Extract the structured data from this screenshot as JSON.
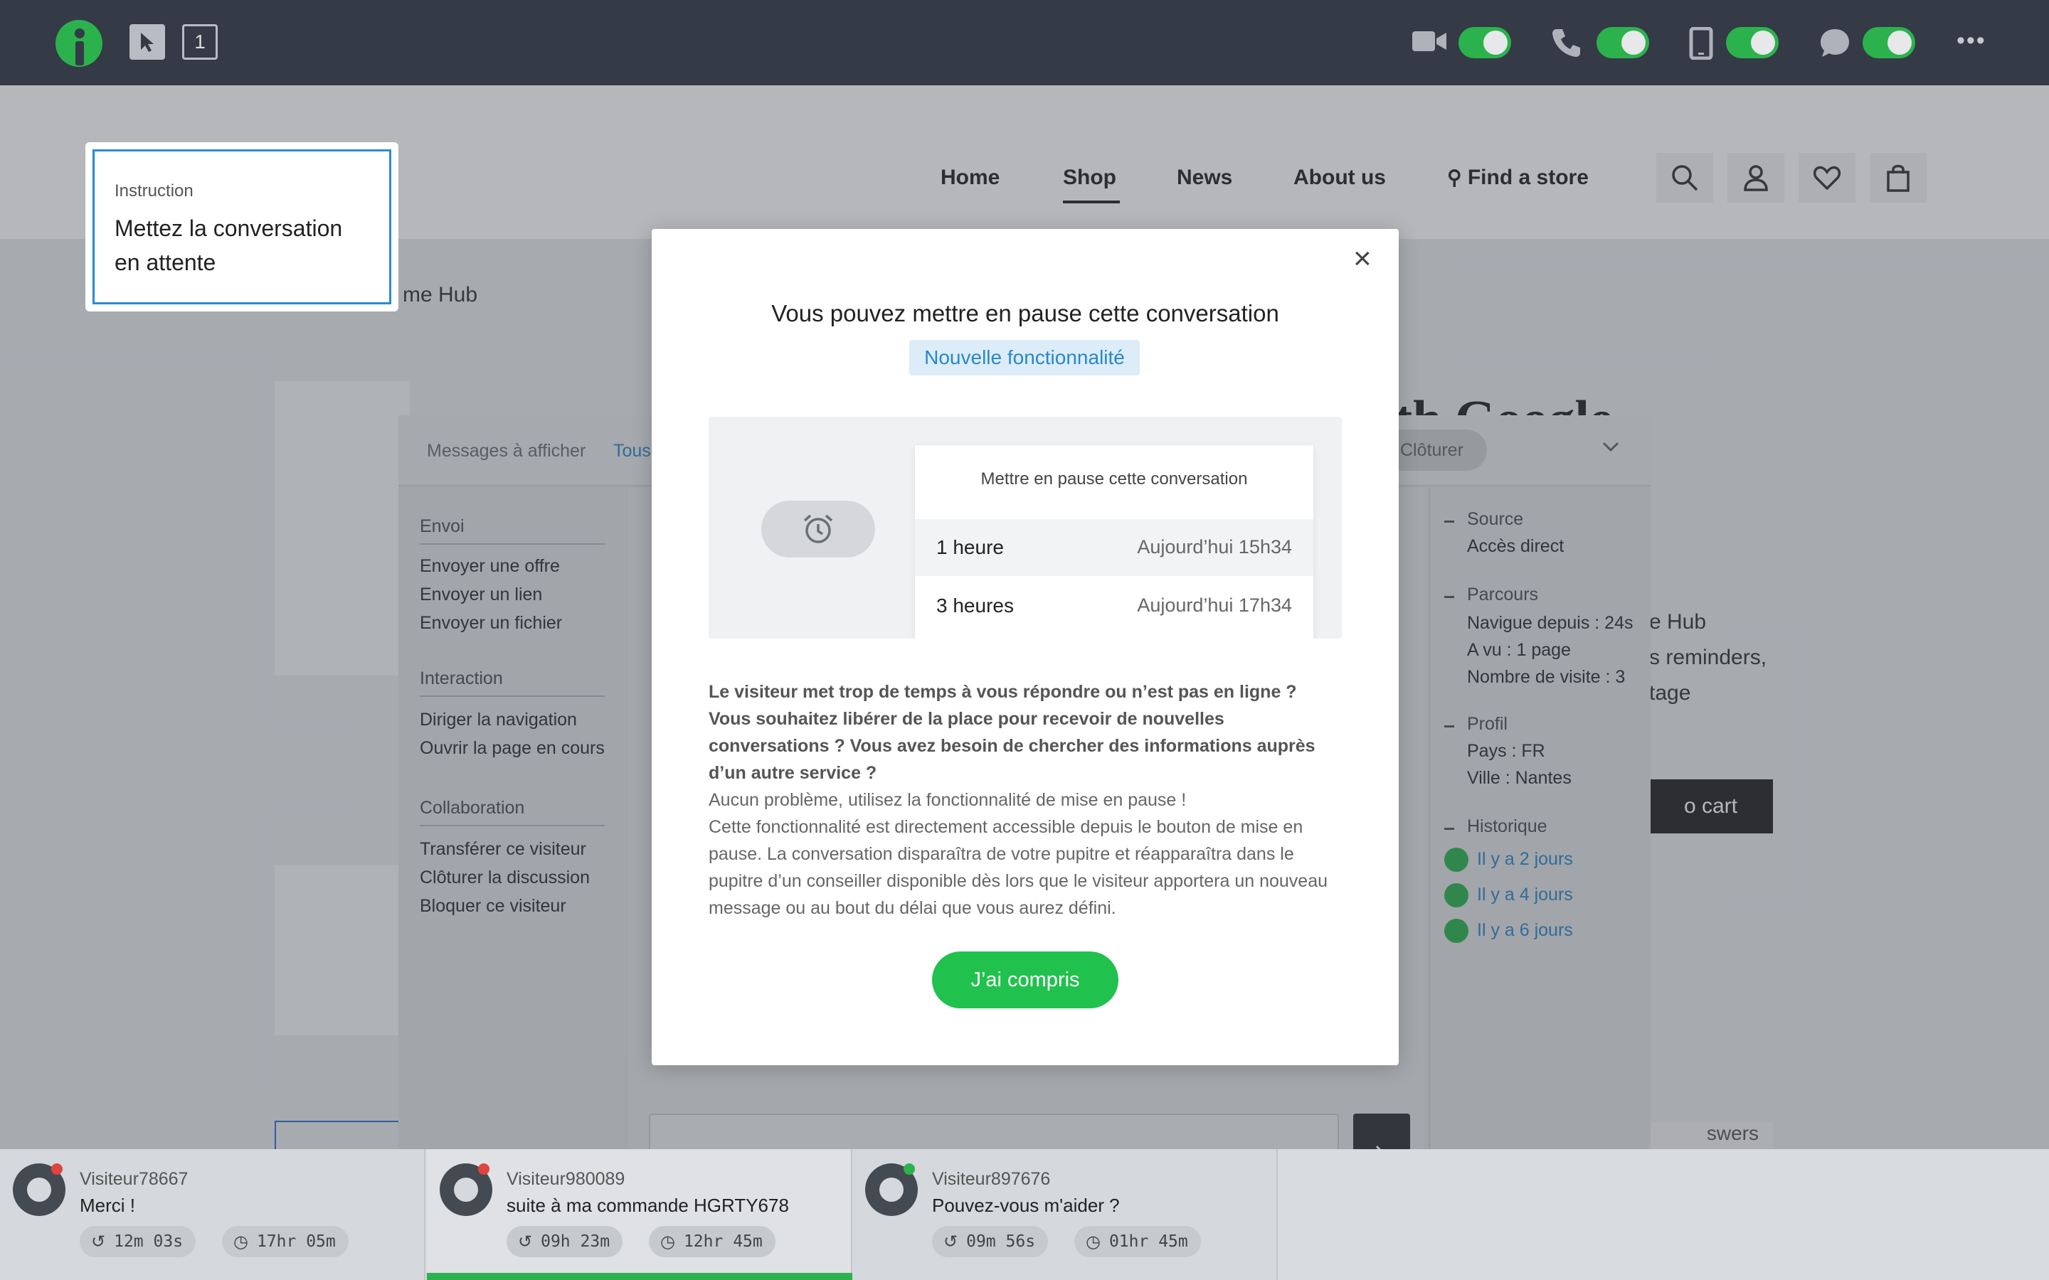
{
  "topbar": {
    "cursor_label": "",
    "counter": "1",
    "icons": [
      "video-icon",
      "phone-icon",
      "mobile-icon",
      "chat-icon"
    ],
    "more": "•••"
  },
  "site": {
    "nav": [
      "Home",
      "Shop",
      "News",
      "About us",
      "Find a store"
    ],
    "breadcrumb_fragment": "me Hub",
    "hero_fragment": "ith Google",
    "text_fragments": [
      "e Hub",
      "s reminders,",
      "tage"
    ],
    "cart_fragment": "o cart",
    "answers_fragment": "swers"
  },
  "instruction": {
    "label": "Instruction",
    "text": "Mettez la conversation en attente"
  },
  "console": {
    "filter_label": "Messages à afficher",
    "filter_value": "Tous",
    "close_button": "Clôturer",
    "menu": {
      "envoi_title": "Envoi",
      "envoi_items": [
        "Envoyer une offre",
        "Envoyer un lien",
        "Envoyer un fichier"
      ],
      "interaction_title": "Interaction",
      "interaction_items": [
        "Diriger la navigation",
        "Ouvrir la page en cours"
      ],
      "collab_title": "Collaboration",
      "collab_items": [
        "Transférer ce visiteur",
        "Clôturer la discussion",
        "Bloquer ce visiteur"
      ]
    },
    "info": {
      "source_title": "Source",
      "source_value": "Accès direct",
      "parcours_title": "Parcours",
      "parcours_values": [
        "Navigue depuis : 24s",
        "A vu : 1 page",
        "Nombre de visite : 3"
      ],
      "profil_title": "Profil",
      "profil_values": [
        "Pays : FR",
        "Ville : Nantes"
      ],
      "historique_title": "Historique",
      "historique_values": [
        "Il y a 2 jours",
        "Il y a 4 jours",
        "Il y a 6 jours"
      ]
    }
  },
  "modal": {
    "title": "Vous pouvez mettre en pause cette conversation",
    "badge": "Nouvelle fonctionnalité",
    "preview": {
      "header": "Mettre en pause cette conversation",
      "options": [
        {
          "label": "1 heure",
          "time": "Aujourd’hui 15h34"
        },
        {
          "label": "3 heures",
          "time": "Aujourd’hui 17h34"
        }
      ]
    },
    "para1": "Le visiteur met trop de temps à vous répondre ou n’est pas en ligne ?  Vous souhaitez libérer de la place pour recevoir de nouvelles conversations ? Vous avez besoin de chercher des informations auprès d’un autre service ?",
    "para2_line1": "Aucun problème, utilisez la fonctionnalité de mise en pause !",
    "para2_rest": "Cette fonctionnalité est directement accessible depuis le bouton de mise en pause. La conversation disparaîtra de votre pupitre et réapparaîtra dans le pupitre d’un conseiller disponible dès lors que le visiteur apportera un nouveau message ou au bout du délai que vous aurez défini.",
    "button": "J’ai compris",
    "close": "×"
  },
  "conversations": [
    {
      "name": "Visiteur78667",
      "message": "Merci !",
      "t1": "12m 03s",
      "t2": "17hr 05m",
      "status_color": "#e0443e"
    },
    {
      "name": "Visiteur980089",
      "message": "suite à ma commande HGRTY678",
      "t1": "09h 23m",
      "t2": "12hr 45m",
      "status_color": "#e0443e"
    },
    {
      "name": "Visiteur897676",
      "message": "Pouvez-vous m'aider ?",
      "t1": "09m 56s",
      "t2": "01hr 45m",
      "status_color": "#2bb24c"
    }
  ],
  "colors": {
    "accent": "#2bb24c",
    "link": "#2a87c8",
    "topbar": "#343a46"
  }
}
